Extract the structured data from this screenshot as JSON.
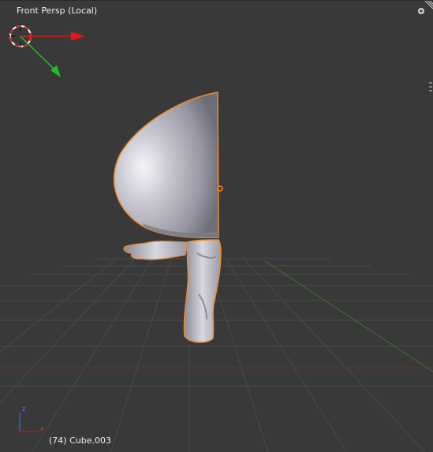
{
  "viewport": {
    "title": "Front Persp (Local)",
    "object_info": "(74) Cube.003"
  },
  "colors": {
    "background": "#393939",
    "grid_line": "#4a4a4a",
    "x_axis": "#8a2a2a",
    "y_axis": "#3f7a2f",
    "selection_outline": "#f08a28",
    "mesh": "#b8b8c2",
    "text": "#f0f0f0",
    "gizmo_x": "#e01818",
    "gizmo_y": "#22c022",
    "mini_axis_z": "#3a5fd0",
    "mini_axis_x": "#d01010"
  },
  "icons": {
    "corner_plus": "plus-icon",
    "corner_hatch": "region-split-icon",
    "cursor_3d": "3d-cursor-icon"
  },
  "mini_axis": {
    "z_label": "z",
    "x_label": "x"
  }
}
